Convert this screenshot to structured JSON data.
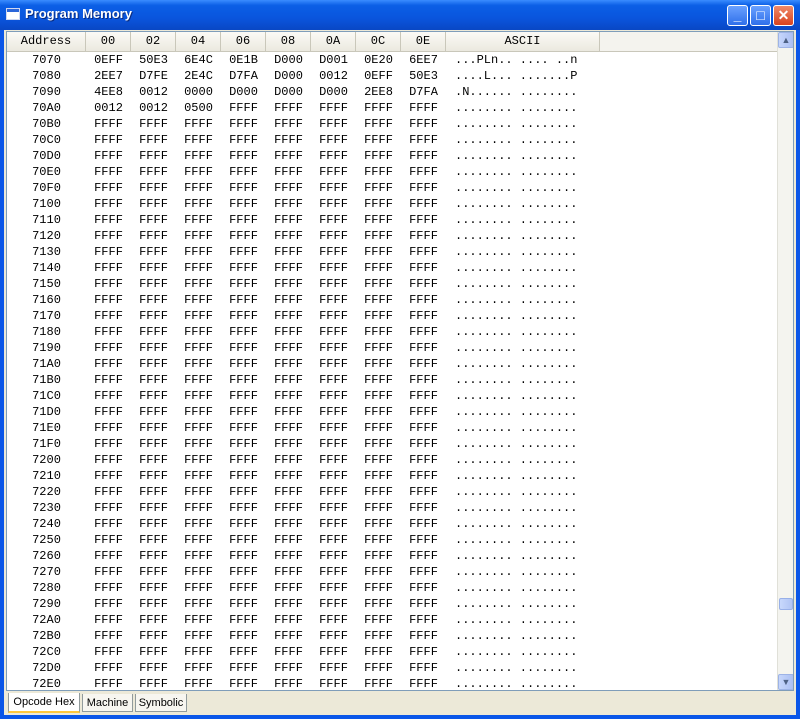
{
  "window": {
    "title": "Program Memory"
  },
  "title_buttons": {
    "minimize": "_",
    "maximize": "□",
    "close": "✕"
  },
  "columns": [
    "Address",
    "00",
    "02",
    "04",
    "06",
    "08",
    "0A",
    "0C",
    "0E",
    "ASCII"
  ],
  "rows": [
    [
      "7070",
      "0EFF",
      "50E3",
      "6E4C",
      "0E1B",
      "D000",
      "D001",
      "0E20",
      "6EE7",
      "...PLn.. .... ..n"
    ],
    [
      "7080",
      "2EE7",
      "D7FE",
      "2E4C",
      "D7FA",
      "D000",
      "0012",
      "0EFF",
      "50E3",
      "....L... .......P"
    ],
    [
      "7090",
      "4EE8",
      "0012",
      "0000",
      "D000",
      "D000",
      "D000",
      "2EE8",
      "D7FA",
      ".N...... ........"
    ],
    [
      "70A0",
      "0012",
      "0012",
      "0500",
      "FFFF",
      "FFFF",
      "FFFF",
      "FFFF",
      "FFFF",
      "........ ........"
    ],
    [
      "70B0",
      "FFFF",
      "FFFF",
      "FFFF",
      "FFFF",
      "FFFF",
      "FFFF",
      "FFFF",
      "FFFF",
      "........ ........"
    ],
    [
      "70C0",
      "FFFF",
      "FFFF",
      "FFFF",
      "FFFF",
      "FFFF",
      "FFFF",
      "FFFF",
      "FFFF",
      "........ ........"
    ],
    [
      "70D0",
      "FFFF",
      "FFFF",
      "FFFF",
      "FFFF",
      "FFFF",
      "FFFF",
      "FFFF",
      "FFFF",
      "........ ........"
    ],
    [
      "70E0",
      "FFFF",
      "FFFF",
      "FFFF",
      "FFFF",
      "FFFF",
      "FFFF",
      "FFFF",
      "FFFF",
      "........ ........"
    ],
    [
      "70F0",
      "FFFF",
      "FFFF",
      "FFFF",
      "FFFF",
      "FFFF",
      "FFFF",
      "FFFF",
      "FFFF",
      "........ ........"
    ],
    [
      "7100",
      "FFFF",
      "FFFF",
      "FFFF",
      "FFFF",
      "FFFF",
      "FFFF",
      "FFFF",
      "FFFF",
      "........ ........"
    ],
    [
      "7110",
      "FFFF",
      "FFFF",
      "FFFF",
      "FFFF",
      "FFFF",
      "FFFF",
      "FFFF",
      "FFFF",
      "........ ........"
    ],
    [
      "7120",
      "FFFF",
      "FFFF",
      "FFFF",
      "FFFF",
      "FFFF",
      "FFFF",
      "FFFF",
      "FFFF",
      "........ ........"
    ],
    [
      "7130",
      "FFFF",
      "FFFF",
      "FFFF",
      "FFFF",
      "FFFF",
      "FFFF",
      "FFFF",
      "FFFF",
      "........ ........"
    ],
    [
      "7140",
      "FFFF",
      "FFFF",
      "FFFF",
      "FFFF",
      "FFFF",
      "FFFF",
      "FFFF",
      "FFFF",
      "........ ........"
    ],
    [
      "7150",
      "FFFF",
      "FFFF",
      "FFFF",
      "FFFF",
      "FFFF",
      "FFFF",
      "FFFF",
      "FFFF",
      "........ ........"
    ],
    [
      "7160",
      "FFFF",
      "FFFF",
      "FFFF",
      "FFFF",
      "FFFF",
      "FFFF",
      "FFFF",
      "FFFF",
      "........ ........"
    ],
    [
      "7170",
      "FFFF",
      "FFFF",
      "FFFF",
      "FFFF",
      "FFFF",
      "FFFF",
      "FFFF",
      "FFFF",
      "........ ........"
    ],
    [
      "7180",
      "FFFF",
      "FFFF",
      "FFFF",
      "FFFF",
      "FFFF",
      "FFFF",
      "FFFF",
      "FFFF",
      "........ ........"
    ],
    [
      "7190",
      "FFFF",
      "FFFF",
      "FFFF",
      "FFFF",
      "FFFF",
      "FFFF",
      "FFFF",
      "FFFF",
      "........ ........"
    ],
    [
      "71A0",
      "FFFF",
      "FFFF",
      "FFFF",
      "FFFF",
      "FFFF",
      "FFFF",
      "FFFF",
      "FFFF",
      "........ ........"
    ],
    [
      "71B0",
      "FFFF",
      "FFFF",
      "FFFF",
      "FFFF",
      "FFFF",
      "FFFF",
      "FFFF",
      "FFFF",
      "........ ........"
    ],
    [
      "71C0",
      "FFFF",
      "FFFF",
      "FFFF",
      "FFFF",
      "FFFF",
      "FFFF",
      "FFFF",
      "FFFF",
      "........ ........"
    ],
    [
      "71D0",
      "FFFF",
      "FFFF",
      "FFFF",
      "FFFF",
      "FFFF",
      "FFFF",
      "FFFF",
      "FFFF",
      "........ ........"
    ],
    [
      "71E0",
      "FFFF",
      "FFFF",
      "FFFF",
      "FFFF",
      "FFFF",
      "FFFF",
      "FFFF",
      "FFFF",
      "........ ........"
    ],
    [
      "71F0",
      "FFFF",
      "FFFF",
      "FFFF",
      "FFFF",
      "FFFF",
      "FFFF",
      "FFFF",
      "FFFF",
      "........ ........"
    ],
    [
      "7200",
      "FFFF",
      "FFFF",
      "FFFF",
      "FFFF",
      "FFFF",
      "FFFF",
      "FFFF",
      "FFFF",
      "........ ........"
    ],
    [
      "7210",
      "FFFF",
      "FFFF",
      "FFFF",
      "FFFF",
      "FFFF",
      "FFFF",
      "FFFF",
      "FFFF",
      "........ ........"
    ],
    [
      "7220",
      "FFFF",
      "FFFF",
      "FFFF",
      "FFFF",
      "FFFF",
      "FFFF",
      "FFFF",
      "FFFF",
      "........ ........"
    ],
    [
      "7230",
      "FFFF",
      "FFFF",
      "FFFF",
      "FFFF",
      "FFFF",
      "FFFF",
      "FFFF",
      "FFFF",
      "........ ........"
    ],
    [
      "7240",
      "FFFF",
      "FFFF",
      "FFFF",
      "FFFF",
      "FFFF",
      "FFFF",
      "FFFF",
      "FFFF",
      "........ ........"
    ],
    [
      "7250",
      "FFFF",
      "FFFF",
      "FFFF",
      "FFFF",
      "FFFF",
      "FFFF",
      "FFFF",
      "FFFF",
      "........ ........"
    ],
    [
      "7260",
      "FFFF",
      "FFFF",
      "FFFF",
      "FFFF",
      "FFFF",
      "FFFF",
      "FFFF",
      "FFFF",
      "........ ........"
    ],
    [
      "7270",
      "FFFF",
      "FFFF",
      "FFFF",
      "FFFF",
      "FFFF",
      "FFFF",
      "FFFF",
      "FFFF",
      "........ ........"
    ],
    [
      "7280",
      "FFFF",
      "FFFF",
      "FFFF",
      "FFFF",
      "FFFF",
      "FFFF",
      "FFFF",
      "FFFF",
      "........ ........"
    ],
    [
      "7290",
      "FFFF",
      "FFFF",
      "FFFF",
      "FFFF",
      "FFFF",
      "FFFF",
      "FFFF",
      "FFFF",
      "........ ........"
    ],
    [
      "72A0",
      "FFFF",
      "FFFF",
      "FFFF",
      "FFFF",
      "FFFF",
      "FFFF",
      "FFFF",
      "FFFF",
      "........ ........"
    ],
    [
      "72B0",
      "FFFF",
      "FFFF",
      "FFFF",
      "FFFF",
      "FFFF",
      "FFFF",
      "FFFF",
      "FFFF",
      "........ ........"
    ],
    [
      "72C0",
      "FFFF",
      "FFFF",
      "FFFF",
      "FFFF",
      "FFFF",
      "FFFF",
      "FFFF",
      "FFFF",
      "........ ........"
    ],
    [
      "72D0",
      "FFFF",
      "FFFF",
      "FFFF",
      "FFFF",
      "FFFF",
      "FFFF",
      "FFFF",
      "FFFF",
      "........ ........"
    ],
    [
      "72E0",
      "FFFF",
      "FFFF",
      "FFFF",
      "FFFF",
      "FFFF",
      "FFFF",
      "FFFF",
      "FFFF",
      "........ ........"
    ]
  ],
  "tabs": [
    {
      "label": "Opcode Hex",
      "active": true
    },
    {
      "label": "Machine",
      "active": false
    },
    {
      "label": "Symbolic",
      "active": false
    }
  ],
  "colors": {
    "titlebar": "#0a55dd",
    "tab_highlight": "#ffc83c",
    "grid_border": "#7f9db9"
  }
}
